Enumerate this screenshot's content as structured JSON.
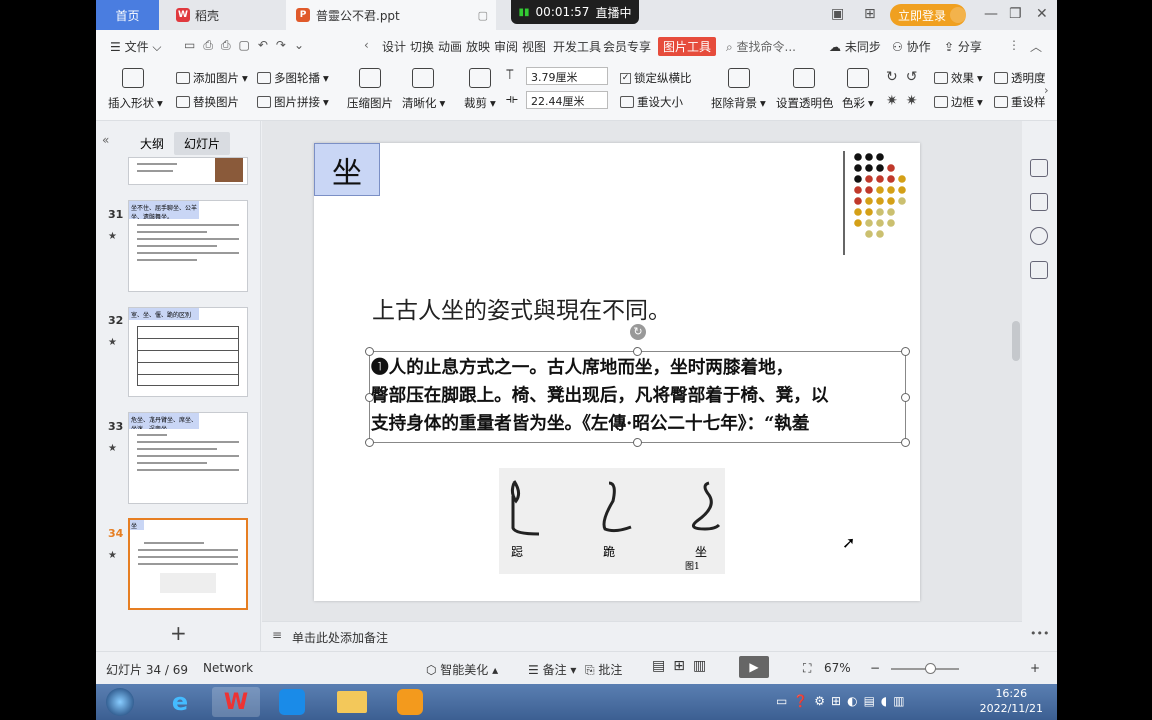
{
  "titlebar": {
    "tab_home": "首页",
    "tab_daoke": "稻壳",
    "tab_doc": "普靈公不君.ppt",
    "timer": "00:01:57",
    "live": "直播中",
    "login": "立即登录"
  },
  "menu": [
    "设计",
    "切换",
    "动画",
    "放映",
    "审阅",
    "视图",
    "开发工具",
    "会员专享"
  ],
  "menu_file": "文件",
  "menu_picture_tools": "图片工具",
  "menu_search": "查找命令...",
  "menu_sync": "未同步",
  "menu_collab": "协作",
  "menu_share": "分享",
  "ribbon": {
    "insert_shape": "插入形状",
    "add_picture": "添加图片",
    "replace_picture": "替换图片",
    "multi_carousel": "多图轮播",
    "picture_collage": "图片拼接",
    "compress": "压缩图片",
    "sharpen": "清晰化",
    "crop": "裁剪",
    "height_value": "3.79厘米",
    "width_value": "22.44厘米",
    "lock_ratio": "锁定纵横比",
    "reset_size": "重设大小",
    "remove_bg": "抠除背景",
    "set_transparent": "设置透明色",
    "color": "色彩",
    "effects": "效果",
    "transparency": "透明度",
    "border": "边框",
    "reset_picture": "重设样"
  },
  "leftpane": {
    "tab_outline": "大纲",
    "tab_slides": "幻灯片",
    "thumbs": [
      {
        "num": "31",
        "title": "坐不住、屈手聊坐、公羊坐、遗骸舞坐。"
      },
      {
        "num": "32",
        "title": "室、坐、偃、跪的区別"
      },
      {
        "num": "33",
        "title": "危坐、尨丹臂坐、席坐、坐迷、逞斋坐"
      },
      {
        "num": "34",
        "title": "坐"
      }
    ],
    "add": "+"
  },
  "slide": {
    "title": "坐",
    "subtitle": "上古人坐的姿式與現在不同。",
    "body_lines": [
      "❶人的止息方式之一。古人席地而坐，坐时两膝着地，",
      "臀部压在脚跟上。椅、凳出现后，凡将臀部着于椅、凳，以",
      "支持身体的重量者皆为坐。《左傳·昭公二十七年》：“執羞"
    ],
    "figure_labels": [
      "跽",
      "跪",
      "坐"
    ],
    "figure_caption": "图1"
  },
  "notes_placeholder": "单击此处添加备注",
  "status": {
    "slide_info": "幻灯片 34 / 69",
    "theme": "Network",
    "beautify": "智能美化",
    "notes": "备注",
    "comments": "批注",
    "zoom": "67%"
  },
  "clock": {
    "time": "16:26",
    "date": "2022/11/21"
  }
}
